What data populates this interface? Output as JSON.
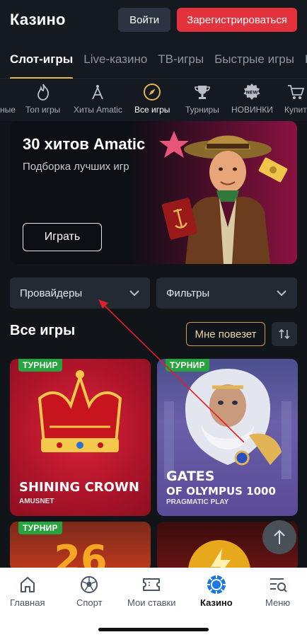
{
  "header": {
    "title": "Казино",
    "login_label": "Войти",
    "register_label": "Зарегистрироваться"
  },
  "tabs": [
    {
      "label": "Слот-игры",
      "active": true
    },
    {
      "label": "Live-казино"
    },
    {
      "label": "ТВ-игры"
    },
    {
      "label": "Быстрые игры"
    },
    {
      "label": "Б"
    }
  ],
  "categories": [
    {
      "label": "ные",
      "icon": "none"
    },
    {
      "label": "Топ игры",
      "icon": "flame-icon"
    },
    {
      "label": "Хиты Amatic",
      "icon": "amatic-icon"
    },
    {
      "label": "Все игры",
      "icon": "compass-icon",
      "active": true
    },
    {
      "label": "Турниры",
      "icon": "trophy-icon"
    },
    {
      "label": "НОВИНКИ",
      "icon": "new-badge-icon"
    },
    {
      "label": "Купит",
      "icon": "cart-icon"
    }
  ],
  "banner": {
    "title": "30 хитов Amatic",
    "subtitle": "Подборка лучших игр",
    "play_label": "Играть"
  },
  "filters": {
    "providers_label": "Провайдеры",
    "filters_label": "Фильтры"
  },
  "section": {
    "title": "Все игры",
    "lucky_label": "Мне повезет"
  },
  "games": [
    {
      "badge": "ТУРНИР",
      "name_line1": "SHINING CROWN",
      "name_line2": "",
      "provider": "AMUSNET"
    },
    {
      "badge": "ТУРНИР",
      "name_line1": "GATES",
      "name_line2": "OF OLYMPUS 1000",
      "provider": "PRAGMATIC PLAY"
    },
    {
      "badge": "ТУРНИР",
      "name_line1": "",
      "name_line2": "",
      "provider": ""
    },
    {
      "badge": "",
      "name_line1": "",
      "name_line2": "",
      "provider": ""
    }
  ],
  "bottom_nav": [
    {
      "label": "Главная",
      "icon": "home-icon"
    },
    {
      "label": "Спорт",
      "icon": "soccer-ball-icon"
    },
    {
      "label": "Мои ставки",
      "icon": "ticket-icon"
    },
    {
      "label": "Казино",
      "icon": "casino-chip-icon",
      "active": true
    },
    {
      "label": "Меню",
      "icon": "menu-search-icon"
    }
  ],
  "colors": {
    "accent_gold": "#e2b455",
    "register_red": "#e3323b",
    "tournament_green": "#27a33f",
    "casino_blue": "#1b78e0"
  }
}
